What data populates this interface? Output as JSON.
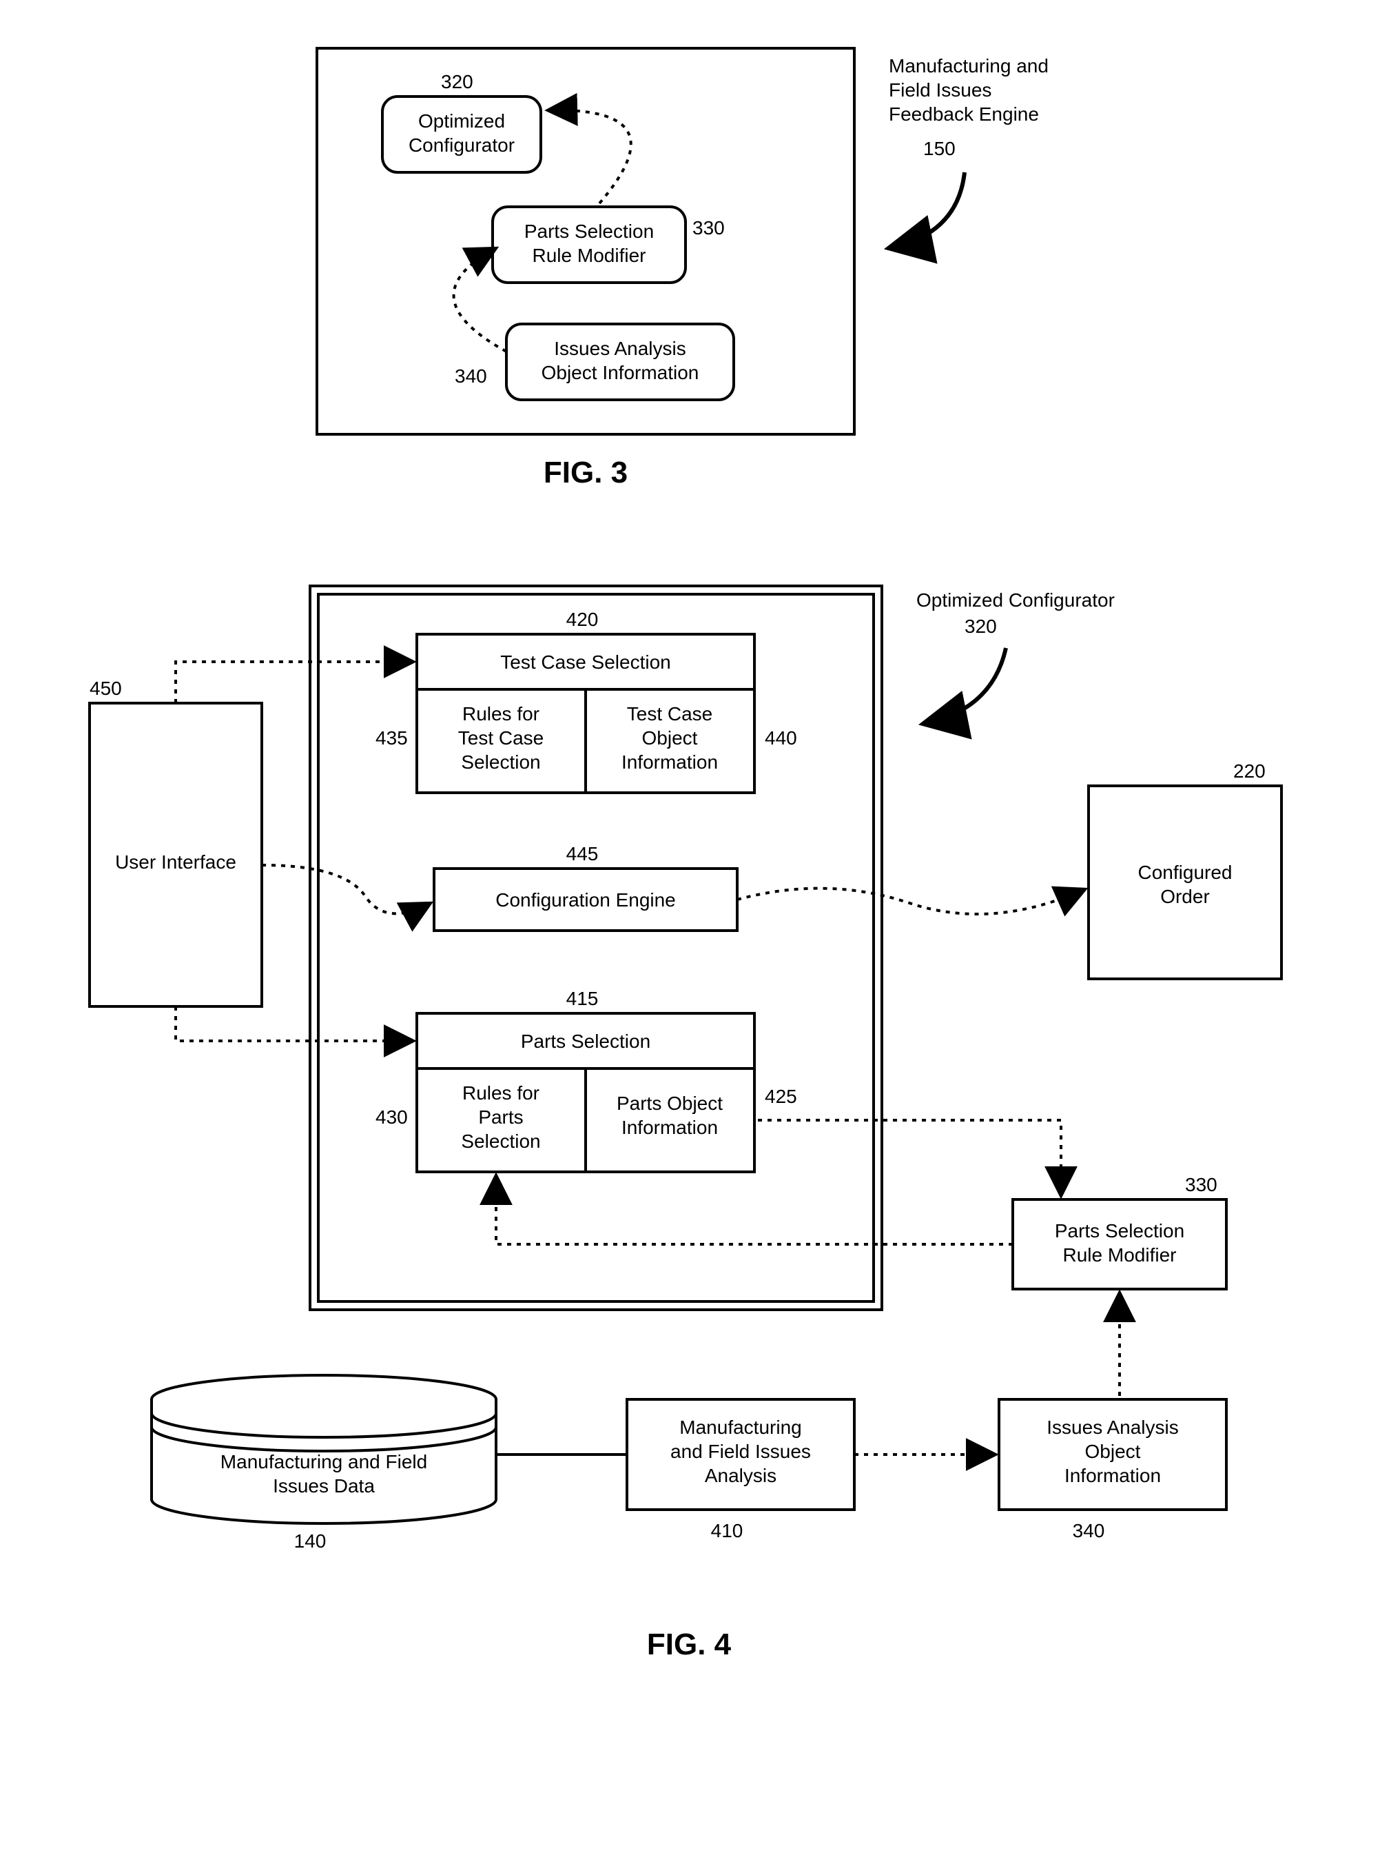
{
  "fig3": {
    "caption": "FIG. 3",
    "outside_label": "Manufacturing and\nField Issues\nFeedback Engine",
    "outside_num": "150",
    "n320": "320",
    "n330": "330",
    "n340": "340",
    "box320": "Optimized\nConfigurator",
    "box330": "Parts Selection\nRule Modifier",
    "box340": "Issues Analysis\nObject Information"
  },
  "fig4": {
    "caption": "FIG. 4",
    "outside_label": "Optimized Configurator",
    "outside_num": "320",
    "n420": "420",
    "n435": "435",
    "n440": "440",
    "n445": "445",
    "n415": "415",
    "n430": "430",
    "n425": "425",
    "n450": "450",
    "n220": "220",
    "n330": "330",
    "n340": "340",
    "n410": "410",
    "n140": "140",
    "box420": "Test Case Selection",
    "box435": "Rules for\nTest Case\nSelection",
    "box440": "Test Case\nObject\nInformation",
    "box445": "Configuration Engine",
    "box415": "Parts Selection",
    "box430": "Rules for\nParts\nSelection",
    "box425b": "Parts Object\nInformation",
    "box450": "User Interface",
    "box220": "Configured\nOrder",
    "box330": "Parts Selection\nRule Modifier",
    "box340": "Issues Analysis\nObject\nInformation",
    "box410": "Manufacturing\nand Field Issues\nAnalysis",
    "box140": "Manufacturing and Field\nIssues Data"
  }
}
